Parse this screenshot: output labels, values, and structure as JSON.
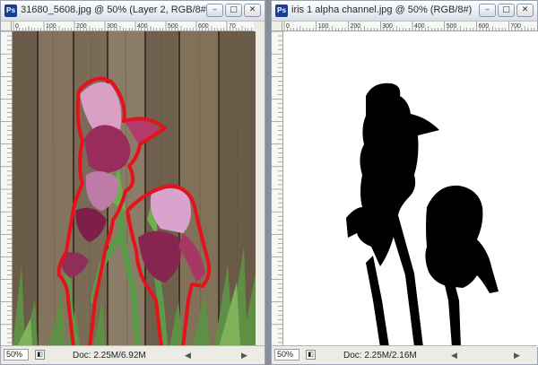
{
  "left_window": {
    "title": "31680_5608.jpg @ 50% (Layer 2, RGB/8#)",
    "app_icon": "Ps",
    "ruler_ticks": [
      "0",
      "100",
      "200",
      "300",
      "400",
      "500",
      "600",
      "70"
    ],
    "ruler_left_ticks": [
      "0",
      "5",
      "1\n0",
      "1\n5",
      "2\n0",
      "2\n5",
      "3\n0",
      "3\n5",
      "4\n0",
      "4\n5",
      "5\n0",
      "5\n5",
      "6\n0",
      "6\n5",
      "7\n0"
    ],
    "zoom": "50%",
    "doc_info": "Doc: 2.25M/6.92M"
  },
  "right_window": {
    "title": "iris 1 alpha channel.jpg @ 50% (RGB/8#)",
    "app_icon": "Ps",
    "ruler_ticks": [
      "0",
      "100",
      "200",
      "300",
      "400",
      "500",
      "600",
      "700"
    ],
    "zoom": "50%",
    "doc_info": "Doc: 2.25M/2.16M"
  },
  "window_buttons": {
    "minimize": "–",
    "maximize": "□",
    "close": "✕"
  },
  "colors": {
    "selection_outline": "#e5121b",
    "mask_shape": "#000000",
    "mask_background": "#ffffff"
  }
}
